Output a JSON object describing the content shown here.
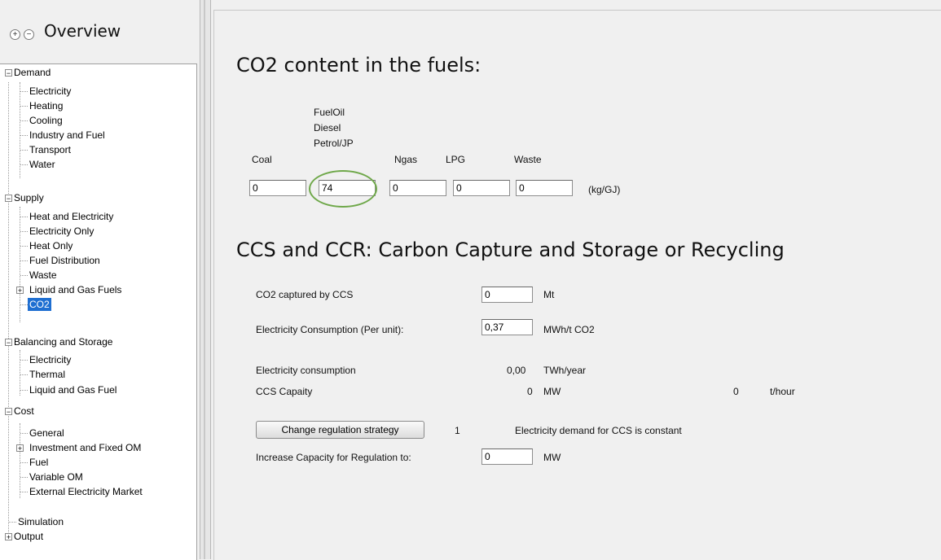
{
  "overview": {
    "title": "Overview",
    "expand_all": "+",
    "collapse_all": "−"
  },
  "tree": {
    "demand": {
      "label": "Demand",
      "children": [
        "Electricity",
        "Heating",
        "Cooling",
        "Industry and Fuel",
        "Transport",
        "Water"
      ]
    },
    "supply": {
      "label": "Supply",
      "children": [
        "Heat and Electricity",
        "Electricity Only",
        "Heat Only",
        "Fuel Distribution",
        "Waste",
        "Liquid and Gas Fuels",
        "CO2"
      ]
    },
    "balancing": {
      "label": "Balancing and Storage",
      "children": [
        "Electricity",
        "Thermal",
        "Liquid and Gas Fuel"
      ]
    },
    "cost": {
      "label": "Cost",
      "children": [
        "General",
        "Investment and Fixed OM",
        "Fuel",
        "Variable OM",
        "External Electricity Market"
      ]
    },
    "simulation": "Simulation",
    "output": "Output",
    "selected": "CO2"
  },
  "co2_section": {
    "title": "CO2 content in the fuels:",
    "headers": [
      "Coal",
      "FuelOil",
      "Diesel",
      "Petrol/JP",
      "Ngas",
      "LPG",
      "Waste"
    ],
    "values": {
      "coal": "0",
      "oil": "74",
      "ngas": "0",
      "lpg": "0",
      "waste": "0"
    },
    "unit": "(kg/GJ)"
  },
  "ccs_section": {
    "title": "CCS and CCR: Carbon Capture and Storage or Recycling",
    "captured_label": "CO2 captured by CCS",
    "captured_value": "0",
    "captured_unit": "Mt",
    "elcons_label": "Electricity Consumption (Per unit):",
    "elcons_value": "0,37",
    "elcons_unit": "MWh/t CO2",
    "elec_consumption_label": "Electricity consumption",
    "elec_consumption_value": "0,00",
    "elec_consumption_unit": "TWh/year",
    "capacity_label": "CCS Capaity",
    "capacity_value": "0",
    "capacity_unit": "MW",
    "capacity_t_value": "0",
    "capacity_t_unit": "t/hour",
    "strategy_button": "Change regulation strategy",
    "strategy_number": "1",
    "strategy_text": "Electricity demand for CCS is constant",
    "increase_label": "Increase Capacity for Regulation to:",
    "increase_value": "0",
    "increase_unit": "MW"
  },
  "colors": {
    "selection": "#1f6fd1",
    "highlight_circle": "#6fa84a"
  }
}
